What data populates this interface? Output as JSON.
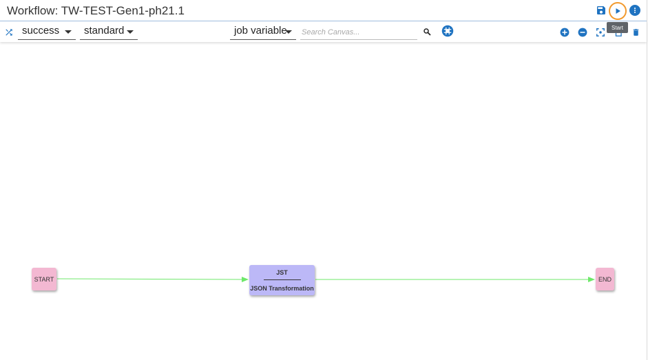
{
  "header": {
    "title": "Workflow: TW-TEST-Gen1-ph21.1",
    "save_icon": "save-icon",
    "start_icon": "play-icon",
    "more_icon": "more-vert-icon",
    "tooltip": "Start",
    "colors": {
      "accent": "#1f73c1",
      "highlight_ring": "#f29a2e",
      "tooltip_bg": "#5f6368"
    }
  },
  "toolbar": {
    "shuffle_icon": "shuffle-icon",
    "status_select": "success",
    "mode_select": "standard",
    "variable_select": "job variable",
    "search_placeholder": "Search Canvas...",
    "search_icon": "search-icon",
    "layout_icon": "layout-icon",
    "zoom_in_icon": "zoom-in-icon",
    "zoom_out_icon": "zoom-out-icon",
    "fit_icon": "fit-screen-icon",
    "copy_icon": "copy-icon",
    "delete_icon": "delete-icon"
  },
  "canvas": {
    "nodes": [
      {
        "id": "start",
        "label": "START",
        "color": "#f3b8d2"
      },
      {
        "id": "jst",
        "label": "JST",
        "sublabel": "JSON Transformation",
        "color": "#bcb8f7"
      },
      {
        "id": "end",
        "label": "END",
        "color": "#f3b8d2"
      }
    ],
    "edge_color": "#6ee86a"
  }
}
